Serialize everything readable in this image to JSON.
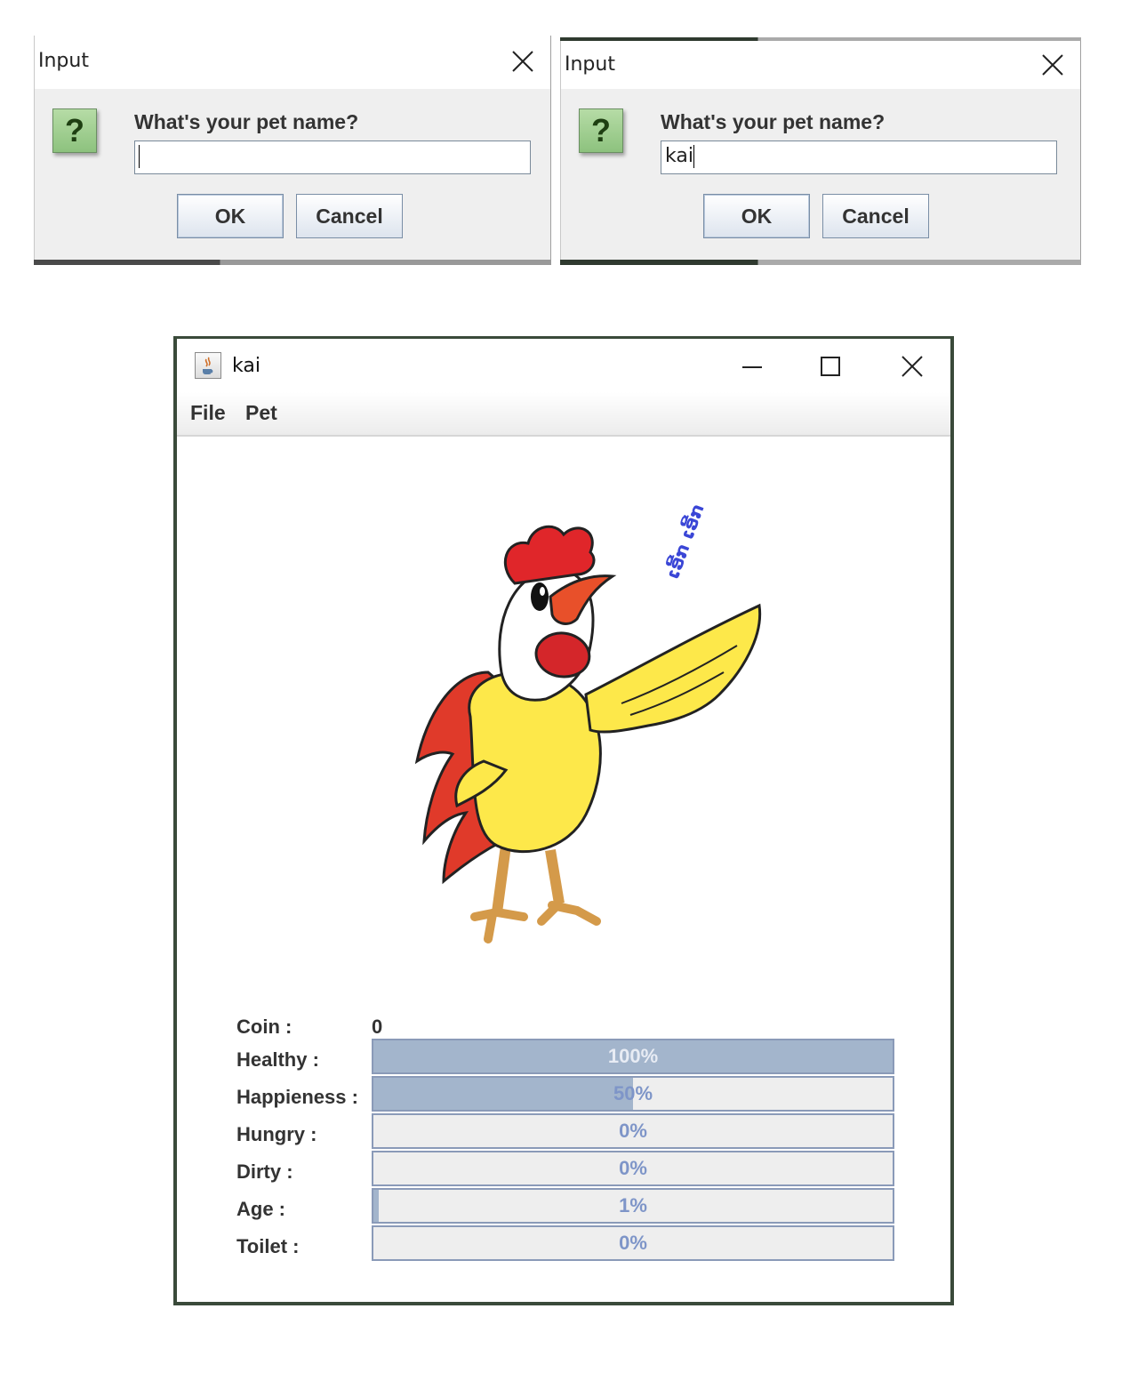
{
  "dialogs": [
    {
      "title": "Input",
      "prompt": "What's your pet name?",
      "field_value": "",
      "ok_label": "OK",
      "cancel_label": "Cancel"
    },
    {
      "title": "Input",
      "prompt": "What's your pet name?",
      "field_value": "kai",
      "ok_label": "OK",
      "cancel_label": "Cancel"
    }
  ],
  "window": {
    "title": "kai",
    "menu": [
      "File",
      "Pet"
    ]
  },
  "pet": {
    "sound_text": "ເອີ້ກ ເອີ້ກ"
  },
  "stats": {
    "coin_label": "Coin :",
    "coin_value": "0",
    "bars": [
      {
        "label": "Healthy :",
        "value": 100,
        "text": "100%"
      },
      {
        "label": "Happieness :",
        "value": 50,
        "text": "50%"
      },
      {
        "label": "Hungry :",
        "value": 0,
        "text": "0%"
      },
      {
        "label": "Dirty :",
        "value": 0,
        "text": "0%"
      },
      {
        "label": "Age :",
        "value": 1,
        "text": "1%"
      },
      {
        "label": "Toilet :",
        "value": 0,
        "text": "0%"
      }
    ]
  },
  "colors": {
    "bar_fill": "#a3b5cc",
    "bar_track": "#eeeeee",
    "bar_text": "#7e95c8",
    "dialog_icon": "#8dc27e"
  }
}
